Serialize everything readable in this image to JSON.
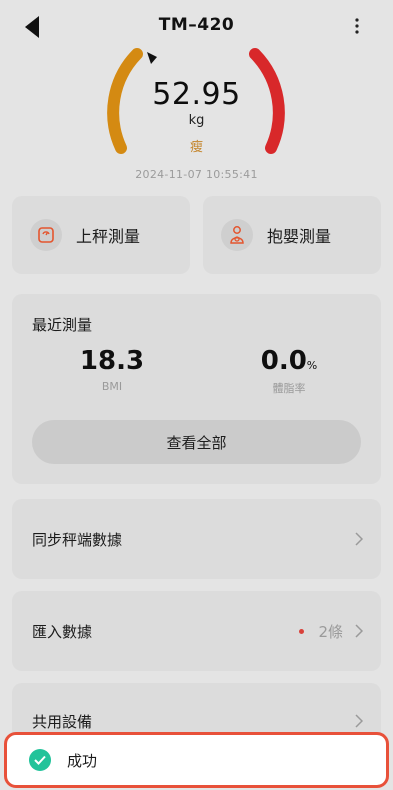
{
  "header": {
    "title": "TM–420"
  },
  "gauge": {
    "weight": "52.95",
    "unit": "kg",
    "status": "瘦",
    "timestamp": "2024-11-07 10:55:41",
    "colors": {
      "left_arc": "#d48a12",
      "right_arc": "#d8282a",
      "pointer": "#111111"
    }
  },
  "actions": [
    {
      "label": "上秤測量",
      "icon": "scale-icon"
    },
    {
      "label": "抱嬰測量",
      "icon": "baby-icon"
    }
  ],
  "recent": {
    "title": "最近測量",
    "bmi_value": "18.3",
    "bmi_label": "BMI",
    "fat_value": "0.0",
    "fat_unit": "%",
    "fat_label": "體脂率",
    "view_all": "查看全部"
  },
  "rows": {
    "sync": "同步秤端數據",
    "import": "匯入數據",
    "import_count": "2條",
    "share": "共用設備"
  },
  "toast": {
    "text": "成功",
    "color": "#22c39a"
  }
}
